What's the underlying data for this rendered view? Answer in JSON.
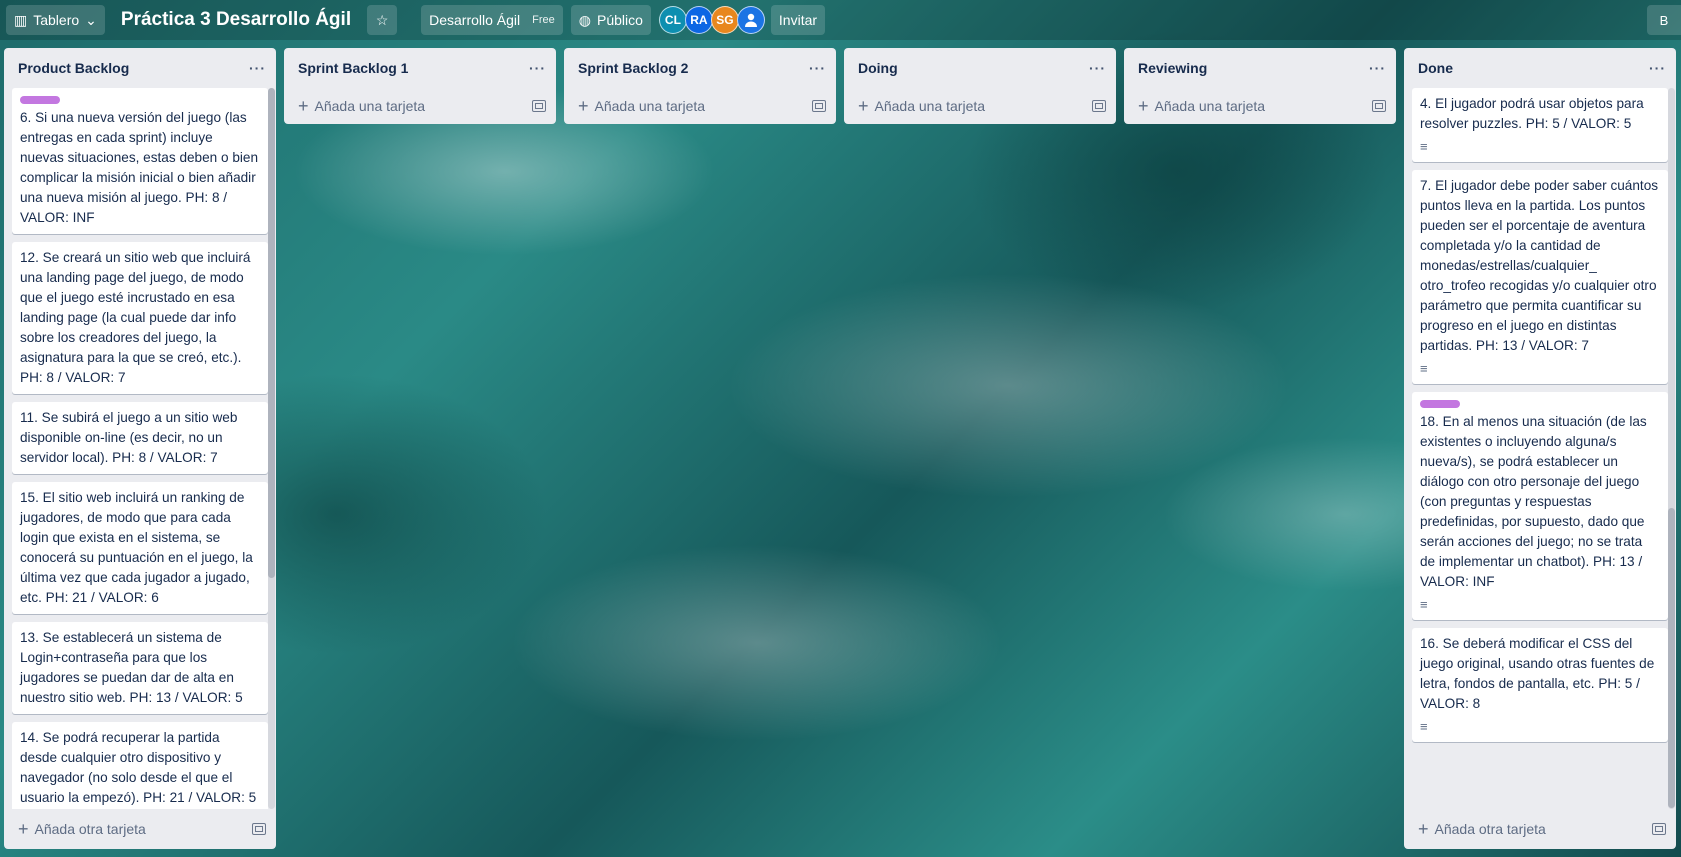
{
  "header": {
    "view_label": "Tablero",
    "board_title": "Práctica 3 Desarrollo Ágil",
    "workspace": "Desarrollo Ágil",
    "workspace_badge": "Free",
    "visibility": "Público",
    "invite": "Invitar",
    "right_label": "B",
    "members": [
      {
        "initials": "CL",
        "color": "#0d8fb0"
      },
      {
        "initials": "RA",
        "color": "#0c66e4"
      },
      {
        "initials": "SG",
        "color": "#e8871e"
      },
      {
        "initials": "",
        "color": "#1b74e4"
      }
    ]
  },
  "lists": [
    {
      "title": "Product Backlog",
      "footer": "Añada otra tarjeta",
      "cards": [
        {
          "label": true,
          "text": "6. Si una nueva versión del juego (las entregas en cada sprint) incluye nuevas situaciones, estas deben o bien complicar la misión inicial o bien añadir una nueva misión al juego. PH: 8 / VALOR: INF",
          "desc": false
        },
        {
          "label": false,
          "text": "12. Se creará un sitio web que incluirá una landing page del juego, de modo que el juego esté incrustado en esa landing page (la cual puede dar info sobre los creadores del juego, la asignatura para la que se creó, etc.). PH: 8 / VALOR: 7",
          "desc": false
        },
        {
          "label": false,
          "text": "11. Se subirá el juego a un sitio web disponible on-line (es decir, no un servidor local). PH: 8 / VALOR: 7",
          "desc": false
        },
        {
          "label": false,
          "text": "15. El sitio web incluirá un ranking de jugadores, de modo que para cada login que exista en el sistema, se conocerá su puntuación en el juego, la última vez que cada jugador a jugado, etc. PH: 21 / VALOR: 6",
          "desc": false
        },
        {
          "label": false,
          "text": "13. Se establecerá un sistema de Login+contraseña para que los jugadores se puedan dar de alta en nuestro sitio web. PH: 13 / VALOR: 5",
          "desc": false
        },
        {
          "label": false,
          "text": "14. Se podrá recuperar la partida desde cualquier otro dispositivo y navegador (no solo desde el que el usuario la empezó). PH: 21 / VALOR: 5",
          "desc": false
        }
      ]
    },
    {
      "title": "Sprint Backlog 1",
      "add": "Añada una tarjeta",
      "cards": []
    },
    {
      "title": "Sprint Backlog 2",
      "add": "Añada una tarjeta",
      "cards": []
    },
    {
      "title": "Doing",
      "add": "Añada una tarjeta",
      "cards": []
    },
    {
      "title": "Reviewing",
      "add": "Añada una tarjeta",
      "cards": []
    },
    {
      "title": "Done",
      "footer": "Añada otra tarjeta",
      "cards": [
        {
          "label": false,
          "text": "4. El jugador podrá usar objetos para resolver puzzles. PH: 5 / VALOR: 5",
          "desc": true
        },
        {
          "label": false,
          "text": "7. El jugador debe poder saber cuántos puntos lleva en la partida. Los puntos pueden ser el porcentaje de aventura completada y/o la cantidad de monedas/estrellas/cualquier_ otro_trofeo recogidas y/o cualquier otro parámetro que permita cuantificar su progreso en el juego en distintas partidas. PH: 13 / VALOR: 7",
          "desc": true
        },
        {
          "label": true,
          "text": "18. En al menos una situación (de las existentes o incluyendo alguna/s nueva/s), se podrá establecer un diálogo con otro personaje del juego (con preguntas y respuestas predefinidas, por supuesto, dado que serán acciones del juego; no se trata de implementar un chatbot). PH: 13 / VALOR: INF",
          "desc": true
        },
        {
          "label": false,
          "text": "16. Se deberá modificar el CSS del juego original, usando otras fuentes de letra, fondos de pantalla, etc. PH: 5 / VALOR: 8",
          "desc": true
        }
      ]
    }
  ]
}
